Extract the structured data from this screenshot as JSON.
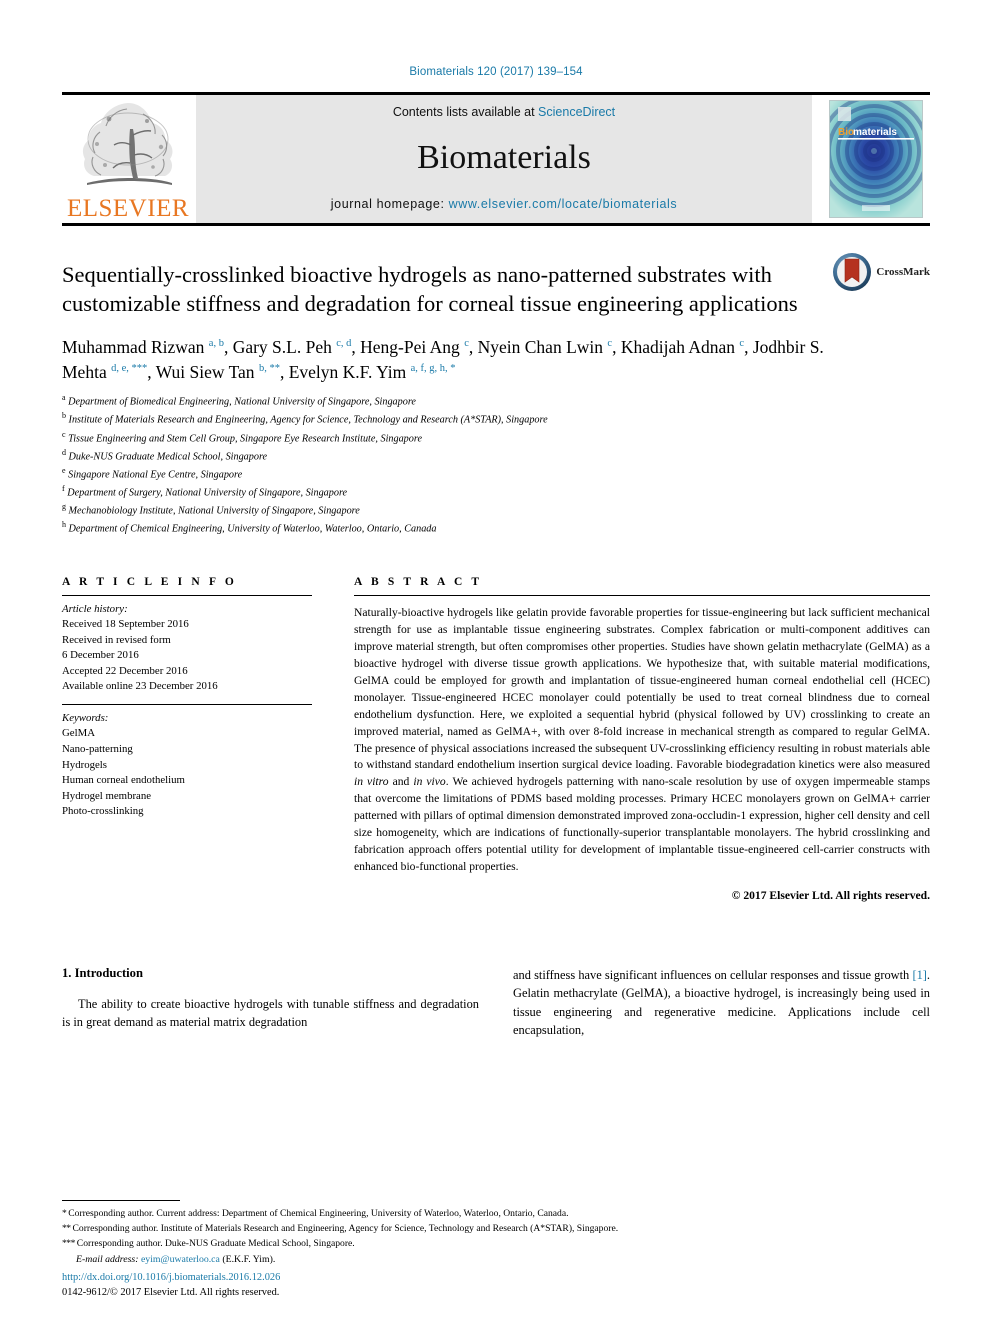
{
  "running_head": "Biomaterials 120 (2017) 139–154",
  "masthead": {
    "publisher_name": "ELSEVIER",
    "contents_prefix": "Contents lists available at ",
    "contents_link": "ScienceDirect",
    "journal_name": "Biomaterials",
    "homepage_prefix": "journal homepage: ",
    "homepage_url": "www.elsevier.com/locate/biomaterials",
    "cover_title_a": "Bio",
    "cover_title_b": "materials"
  },
  "crossmark": {
    "label": "CrossMark"
  },
  "title": "Sequentially-crosslinked bioactive hydrogels as nano-patterned substrates with customizable stiffness and degradation for corneal tissue engineering applications",
  "authors": [
    {
      "name": "Muhammad Rizwan",
      "sup": "a, b",
      "sep": ", "
    },
    {
      "name": "Gary S.L. Peh",
      "sup": "c, d",
      "sep": ", "
    },
    {
      "name": "Heng-Pei Ang",
      "sup": "c",
      "sep": ", "
    },
    {
      "name": "Nyein Chan Lwin",
      "sup": "c",
      "sep": ", "
    },
    {
      "name": "Khadijah Adnan",
      "sup": "c",
      "sep": ", "
    },
    {
      "name": "Jodhbir S. Mehta",
      "sup": "d, e, ***",
      "sep": ", "
    },
    {
      "name": "Wui Siew Tan",
      "sup": "b, **",
      "sep": ", "
    },
    {
      "name": "Evelyn K.F. Yim",
      "sup": "a, f, g, h, *",
      "sep": ""
    }
  ],
  "affiliations": [
    {
      "mark": "a",
      "text": "Department of Biomedical Engineering, National University of Singapore, Singapore"
    },
    {
      "mark": "b",
      "text": "Institute of Materials Research and Engineering, Agency for Science, Technology and Research (A*STAR), Singapore"
    },
    {
      "mark": "c",
      "text": "Tissue Engineering and Stem Cell Group, Singapore Eye Research Institute, Singapore"
    },
    {
      "mark": "d",
      "text": "Duke-NUS Graduate Medical School, Singapore"
    },
    {
      "mark": "e",
      "text": "Singapore National Eye Centre, Singapore"
    },
    {
      "mark": "f",
      "text": "Department of Surgery, National University of Singapore, Singapore"
    },
    {
      "mark": "g",
      "text": "Mechanobiology Institute, National University of Singapore, Singapore"
    },
    {
      "mark": "h",
      "text": "Department of Chemical Engineering, University of Waterloo, Waterloo, Ontario, Canada"
    }
  ],
  "article_info": {
    "heading": "A R T I C L E   I N F O",
    "history_title": "Article history:",
    "history": [
      "Received 18 September 2016",
      "Received in revised form",
      "6 December 2016",
      "Accepted 22 December 2016",
      "Available online 23 December 2016"
    ],
    "keywords_title": "Keywords:",
    "keywords": [
      "GelMA",
      "Nano-patterning",
      "Hydrogels",
      "Human corneal endothelium",
      "Hydrogel membrane",
      "Photo-crosslinking"
    ]
  },
  "abstract": {
    "heading": "A B S T R A C T",
    "text": "Naturally-bioactive hydrogels like gelatin provide favorable properties for tissue-engineering but lack sufficient mechanical strength for use as implantable tissue engineering substrates. Complex fabrication or multi-component additives can improve material strength, but often compromises other properties. Studies have shown gelatin methacrylate (GelMA) as a bioactive hydrogel with diverse tissue growth applications. We hypothesize that, with suitable material modifications, GelMA could be employed for growth and implantation of tissue-engineered human corneal endothelial cell (HCEC) monolayer. Tissue-engineered HCEC monolayer could potentially be used to treat corneal blindness due to corneal endothelium dysfunction. Here, we exploited a sequential hybrid (physical followed by UV) crosslinking to create an improved material, named as GelMA+, with over 8-fold increase in mechanical strength as compared to regular GelMA. The presence of physical associations increased the subsequent UV-crosslinking efficiency resulting in robust materials able to withstand standard endothelium insertion surgical device loading. Favorable biodegradation kinetics were also measured in vitro and in vivo. We achieved hydrogels patterning with nano-scale resolution by use of oxygen impermeable stamps that overcome the limitations of PDMS based molding processes. Primary HCEC monolayers grown on GelMA+ carrier patterned with pillars of optimal dimension demonstrated improved zona-occludin-1 expression, higher cell density and cell size homogeneity, which are indications of functionally-superior transplantable monolayers. The hybrid crosslinking and fabrication approach offers potential utility for development of implantable tissue-engineered cell-carrier constructs with enhanced bio-functional properties.",
    "copyright": "© 2017 Elsevier Ltd. All rights reserved."
  },
  "introduction": {
    "heading": "1. Introduction",
    "col1": "The ability to create bioactive hydrogels with tunable stiffness and degradation is in great demand as material matrix degradation",
    "col2_part1": "and stiffness have significant influences on cellular responses and tissue growth ",
    "col2_ref": "[1]",
    "col2_part2": ". Gelatin methacrylate (GelMA), a bioactive hydrogel, is increasingly being used in tissue engineering and regenerative medicine. Applications include cell encapsulation,"
  },
  "footnotes": [
    {
      "mark": "*",
      "text": "Corresponding author. Current address: Department of Chemical Engineering, University of Waterloo, Waterloo, Ontario, Canada."
    },
    {
      "mark": "**",
      "text": "Corresponding author. Institute of Materials Research and Engineering, Agency for Science, Technology and Research (A*STAR), Singapore."
    },
    {
      "mark": "***",
      "text": "Corresponding author. Duke-NUS Graduate Medical School, Singapore."
    }
  ],
  "email": {
    "label": "E-mail address:",
    "address": "eyim@uwaterloo.ca",
    "attribution": "(E.K.F. Yim)."
  },
  "footer": {
    "doi": "http://dx.doi.org/10.1016/j.biomaterials.2016.12.026",
    "issn": "0142-9612/© 2017 Elsevier Ltd. All rights reserved."
  },
  "colors": {
    "link": "#1a7aa8",
    "elsevier_orange": "#E87722",
    "masthead_gray": "#e6e6e6"
  }
}
